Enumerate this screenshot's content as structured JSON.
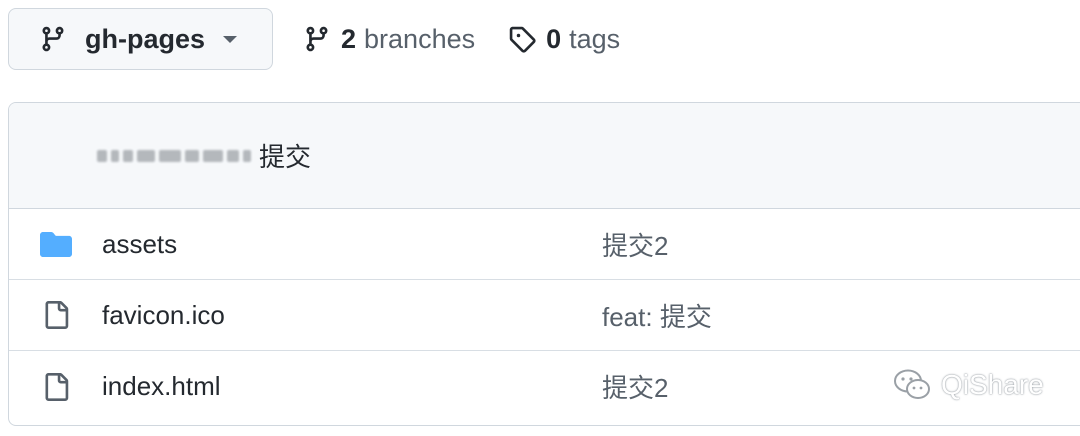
{
  "branch_selector": {
    "label": "gh-pages"
  },
  "branches": {
    "count": "2",
    "label": "branches"
  },
  "tags": {
    "count": "0",
    "label": "tags"
  },
  "latest_commit": {
    "message": "提交"
  },
  "files": [
    {
      "type": "folder",
      "icon": "folder-icon",
      "name": "assets",
      "commit": "提交2"
    },
    {
      "type": "file",
      "icon": "file-icon",
      "name": "favicon.ico",
      "commit": "feat: 提交"
    },
    {
      "type": "file",
      "icon": "file-icon",
      "name": "index.html",
      "commit": "提交2"
    }
  ],
  "watermark": {
    "text": "QiShare"
  },
  "colors": {
    "folder": "#54aeff",
    "border": "#d0d7de",
    "header_bg": "#f6f8fa",
    "muted": "#57606a"
  }
}
